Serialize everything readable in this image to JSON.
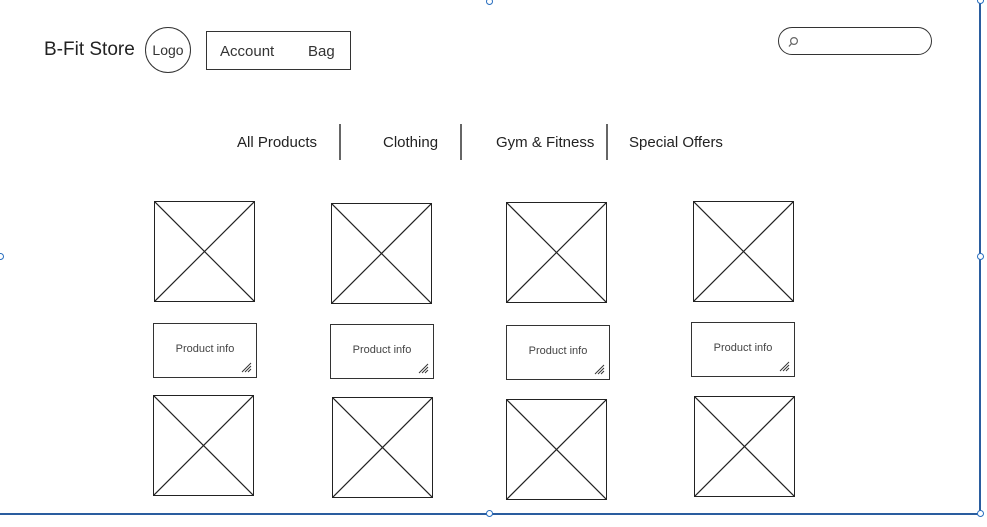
{
  "header": {
    "brand": "B-Fit Store",
    "logo_label": "Logo",
    "account_label": "Account",
    "bag_label": "Bag",
    "search": {
      "value": "",
      "placeholder": ""
    }
  },
  "nav": {
    "items": [
      {
        "label": "All Products"
      },
      {
        "label": "Clothing"
      },
      {
        "label": "Gym & Fitness"
      },
      {
        "label": "Special Offers"
      }
    ]
  },
  "products": {
    "info_labels": [
      "Product info",
      "Product info",
      "Product info",
      "Product info"
    ]
  },
  "colors": {
    "selection_frame": "#2a5d9f",
    "stroke": "#222222",
    "background": "#ffffff"
  },
  "icons": [
    "search-icon",
    "image-placeholder-icon",
    "resize-icon"
  ]
}
